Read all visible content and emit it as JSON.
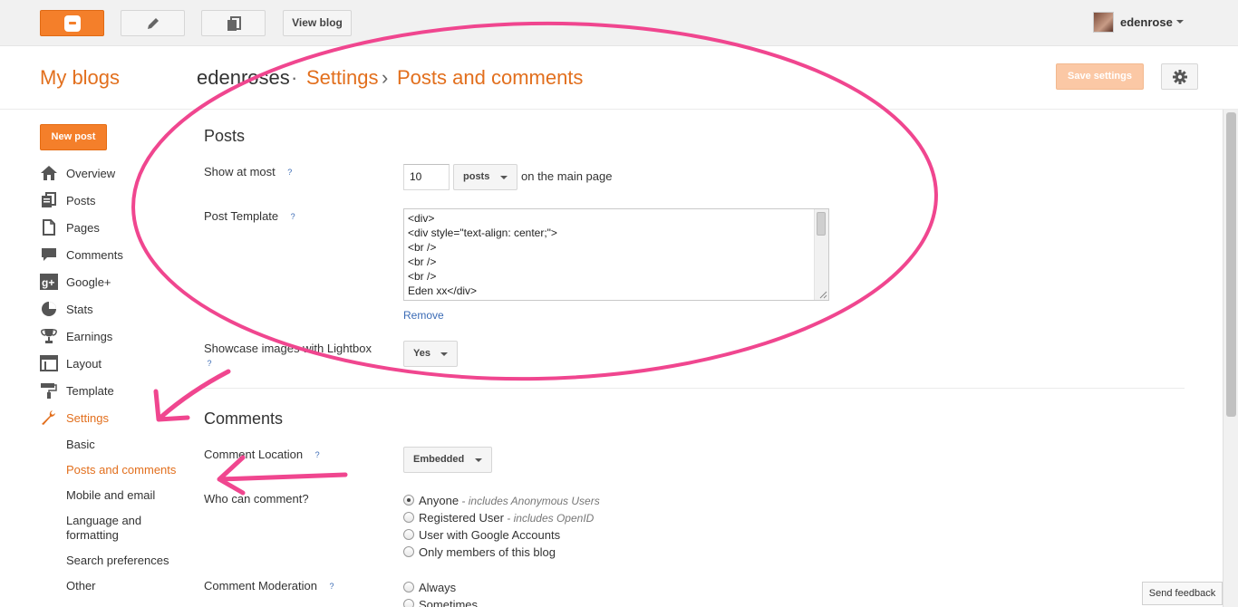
{
  "topbar": {
    "view_blog": "View blog",
    "username": "edenrose"
  },
  "header": {
    "my_blogs": "My blogs",
    "blog_name": "edenroses",
    "dot": "·",
    "settings": "Settings",
    "sep": "›",
    "current": "Posts and comments",
    "save_settings": "Save settings"
  },
  "sidebar": {
    "new_post": "New post",
    "items": [
      {
        "label": "Overview",
        "icon": "home-icon"
      },
      {
        "label": "Posts",
        "icon": "posts-icon"
      },
      {
        "label": "Pages",
        "icon": "pages-icon"
      },
      {
        "label": "Comments",
        "icon": "comments-icon"
      },
      {
        "label": "Google+",
        "icon": "google-plus-icon"
      },
      {
        "label": "Stats",
        "icon": "stats-icon"
      },
      {
        "label": "Earnings",
        "icon": "trophy-icon"
      },
      {
        "label": "Layout",
        "icon": "layout-icon"
      },
      {
        "label": "Template",
        "icon": "paint-roller-icon"
      },
      {
        "label": "Settings",
        "icon": "wrench-icon"
      }
    ],
    "sub_items": [
      "Basic",
      "Posts and comments",
      "Mobile and email",
      "Language and formatting",
      "Search preferences",
      "Other"
    ]
  },
  "posts": {
    "title": "Posts",
    "show_at_most_label": "Show at most",
    "help": "?",
    "show_at_most_value": "10",
    "unit_option": "posts",
    "on_main_page": "on the main page",
    "post_template_label": "Post Template",
    "template_lines": [
      "<div>",
      "<div style=\"text-align: center;\">",
      "<br />",
      "<br />",
      "<br />",
      "Eden xx</div>"
    ],
    "remove": "Remove",
    "lightbox_label": "Showcase images with Lightbox",
    "lightbox_value": "Yes"
  },
  "comments": {
    "title": "Comments",
    "location_label": "Comment Location",
    "location_value": "Embedded",
    "who_label": "Who can comment?",
    "who_options": [
      {
        "label": "Anyone",
        "note": " - includes Anonymous Users",
        "selected": true
      },
      {
        "label": "Registered User",
        "note": " - includes OpenID",
        "selected": false
      },
      {
        "label": "User with Google Accounts",
        "note": "",
        "selected": false
      },
      {
        "label": "Only members of this blog",
        "note": "",
        "selected": false
      }
    ],
    "moderation_label": "Comment Moderation",
    "moderation_options": [
      "Always",
      "Sometimes"
    ]
  },
  "feedback": "Send feedback",
  "colors": {
    "accent": "#e26f1d",
    "annotation": "#f0468f"
  }
}
